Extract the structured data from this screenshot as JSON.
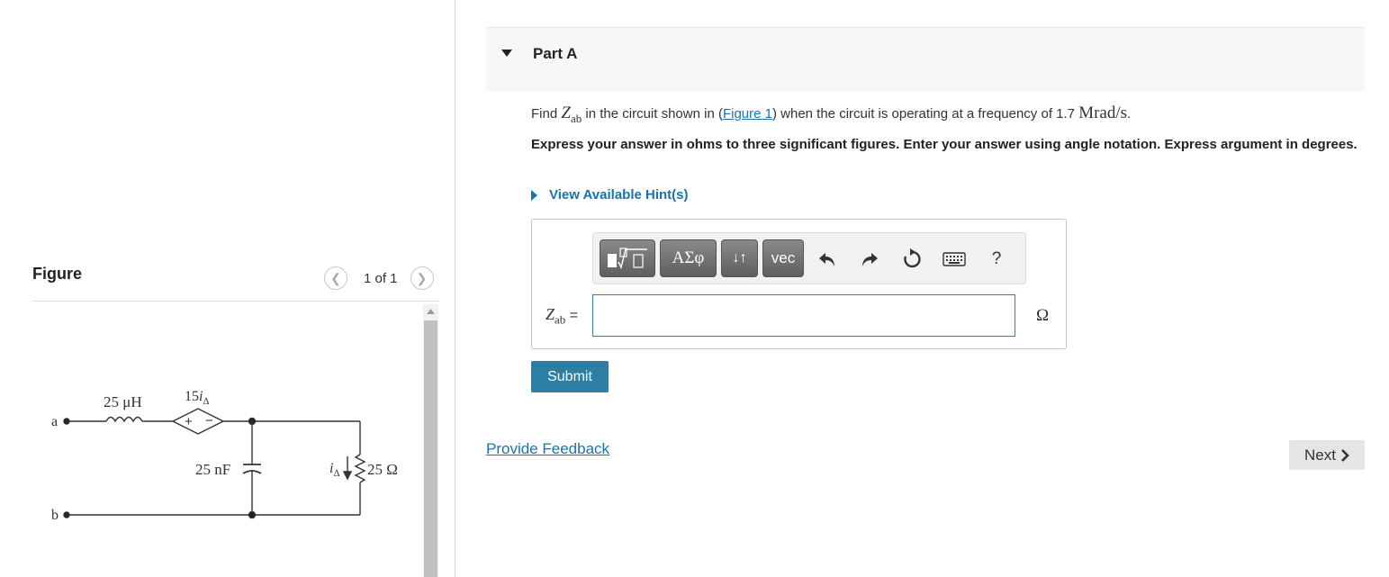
{
  "figure": {
    "title": "Figure",
    "pager_text": "1 of 1",
    "prev_icon": "chevron-left-icon",
    "next_icon": "chevron-right-icon",
    "circuit": {
      "inductor": "25 μH",
      "source_coeff": "15",
      "source_var": "i",
      "source_sub": "Δ",
      "capacitor": "25 nF",
      "resistor": "25 Ω",
      "current_var": "i",
      "current_sub": "Δ",
      "node_a": "a",
      "node_b": "b"
    }
  },
  "part": {
    "title": "Part A",
    "question_before": "Find ",
    "z_symbol": "Z",
    "z_sub": "ab",
    "question_mid": " in the circuit shown in (",
    "figure_link": "Figure 1",
    "question_after": ") when the circuit is operating at a frequency of 1.7 ",
    "freq_unit": "Mrad/s",
    "question_end": ".",
    "instructions": "Express your answer in ohms to three significant figures. Enter your answer using angle notation. Express argument in degrees.",
    "hints_label": "View Available Hint(s)"
  },
  "answer": {
    "label_eq": " =",
    "value": "",
    "unit": "Ω",
    "toolbar": {
      "templates_icon": "math-templates-icon",
      "greek_label": "ΑΣφ",
      "arrows_label": "↓↑",
      "vec_label": "vec",
      "undo_icon": "undo-icon",
      "redo_icon": "redo-icon",
      "reset_icon": "reset-icon",
      "keyboard_icon": "keyboard-icon",
      "help_label": "?"
    }
  },
  "actions": {
    "submit_label": "Submit",
    "feedback_label": "Provide Feedback",
    "next_label": "Next"
  }
}
